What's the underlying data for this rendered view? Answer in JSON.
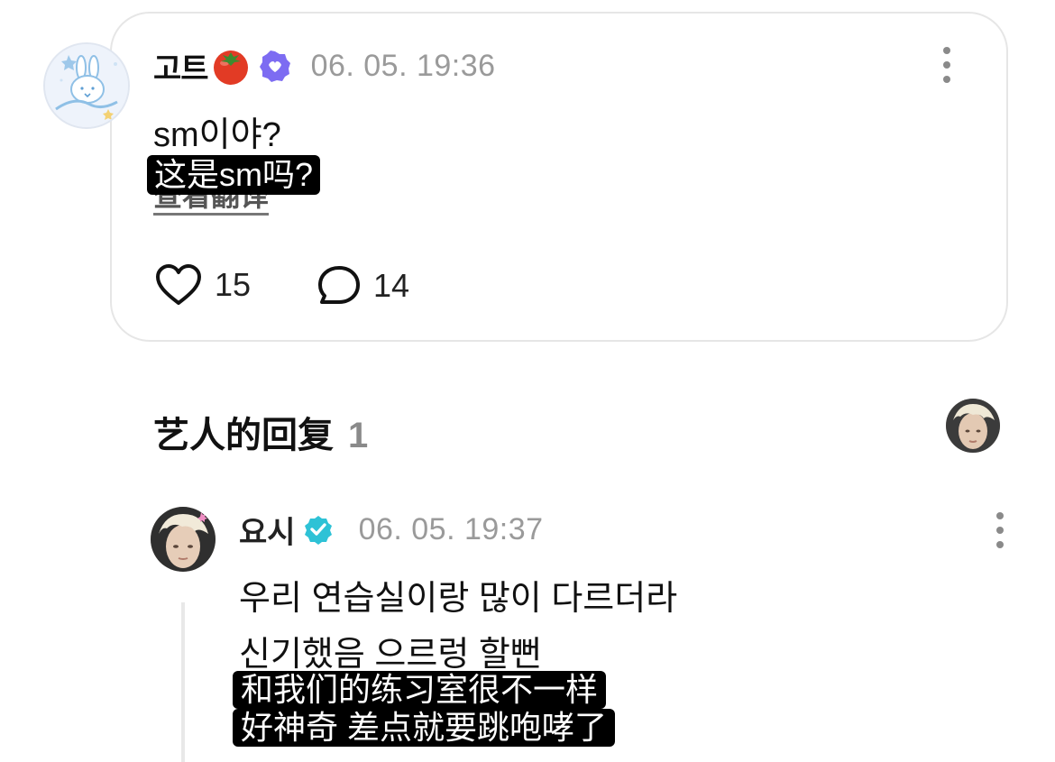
{
  "comment": {
    "author": "고트",
    "timestamp": "06. 05. 19:36",
    "text": "sm이야?",
    "subtitle": "这是sm吗?",
    "translate_link": "查看翻译",
    "likes": "15",
    "replies": "14",
    "icons": {
      "avatar": "bunny-avatar",
      "emoji": "tomato-icon",
      "badge": "verified-badge-icon",
      "more": "more-vertical-icon",
      "like": "heart-icon",
      "reply": "comment-bubble-icon"
    }
  },
  "artist_section": {
    "title": "艺人的回复",
    "count": "1"
  },
  "reply": {
    "author": "요시",
    "timestamp": "06. 05. 19:37",
    "line1": "우리 연습실이랑 많이 다르더라",
    "line2": "신기했음 으르렁 할뻔",
    "subtitle1": "和我们的练习室很不一样",
    "subtitle2": "好神奇 差点就要跳咆哮了"
  },
  "colors": {
    "verified_card": "#7d6cf2",
    "verified_reply": "#2ec2d6",
    "timestamp": "#9a9a9a",
    "border": "#e6e6e6"
  }
}
